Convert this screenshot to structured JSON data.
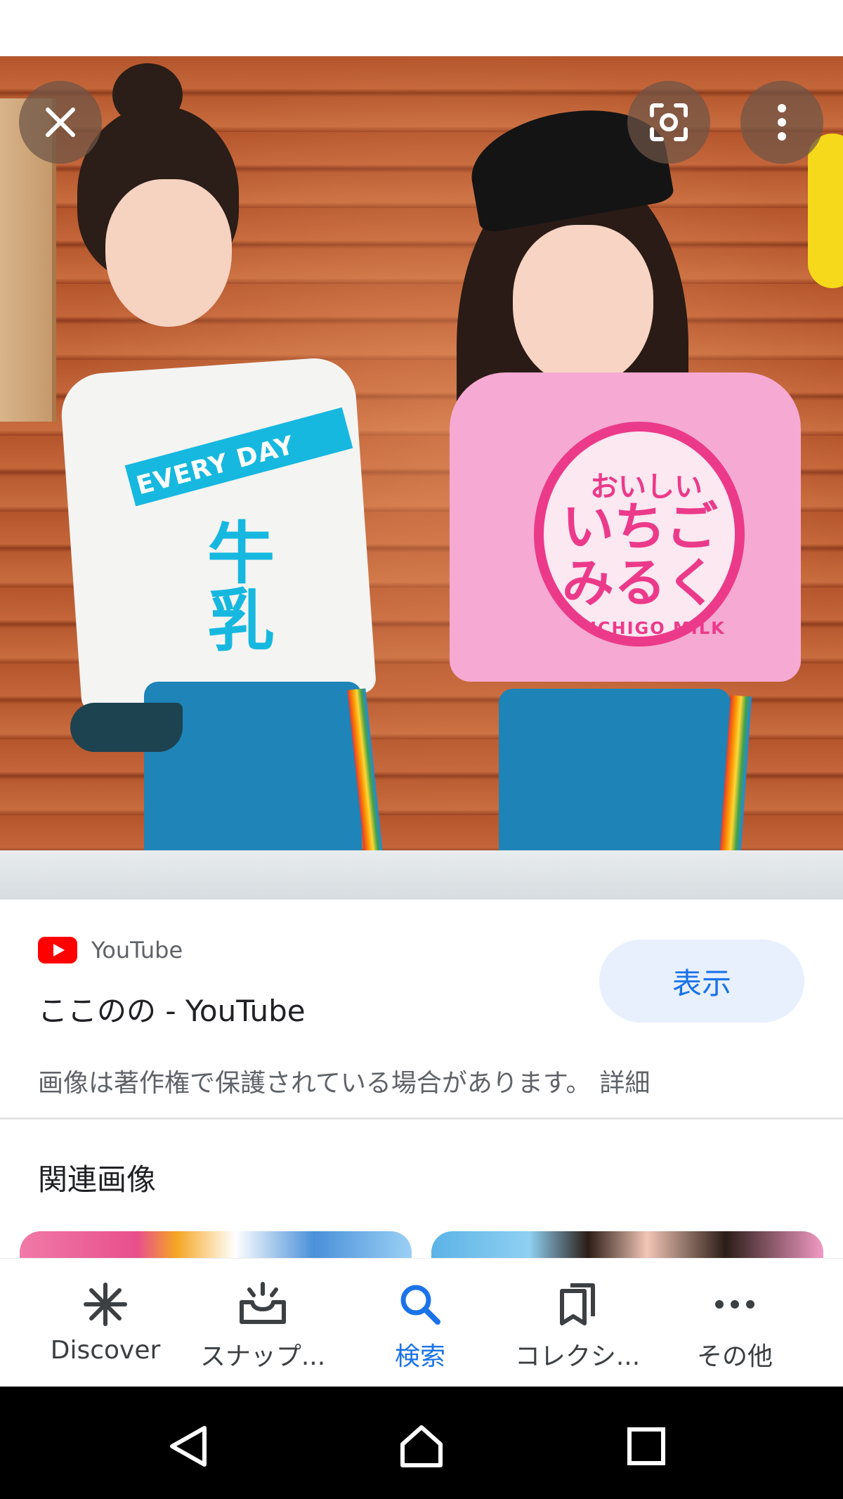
{
  "viewer": {
    "close_icon": "close-icon",
    "lens_icon": "lens-icon",
    "more_icon": "more-vert-icon",
    "image": {
      "shirt_left_band": "EVERY DAY",
      "shirt_left_text": "牛乳",
      "shirt_right_small": "おいしい",
      "shirt_right_big": "いちご みるく",
      "shirt_right_sub": "ICHIGO MILK"
    }
  },
  "result": {
    "source": "YouTube",
    "source_icon": "youtube-icon",
    "title": "ここのの - YouTube",
    "view_button": "表示",
    "copyright": "画像は著作権で保護されている場合があります。",
    "details_link": "詳細"
  },
  "related": {
    "heading": "関連画像"
  },
  "bottom_nav": {
    "items": [
      {
        "label": "Discover",
        "icon": "asterisk-icon",
        "active": false
      },
      {
        "label": "スナップ...",
        "icon": "snapshot-icon",
        "active": false
      },
      {
        "label": "検索",
        "icon": "search-icon",
        "active": true
      },
      {
        "label": "コレクシ...",
        "icon": "collections-icon",
        "active": false
      },
      {
        "label": "その他",
        "icon": "more-horiz-icon",
        "active": false
      }
    ]
  },
  "system_nav": {
    "back_icon": "back-icon",
    "home_icon": "home-icon",
    "recents_icon": "recents-icon"
  },
  "colors": {
    "accent": "#1a73e8",
    "view_button_bg": "#e8f0fe",
    "youtube_red": "#ff0000",
    "secondary_text": "#5f6368"
  }
}
